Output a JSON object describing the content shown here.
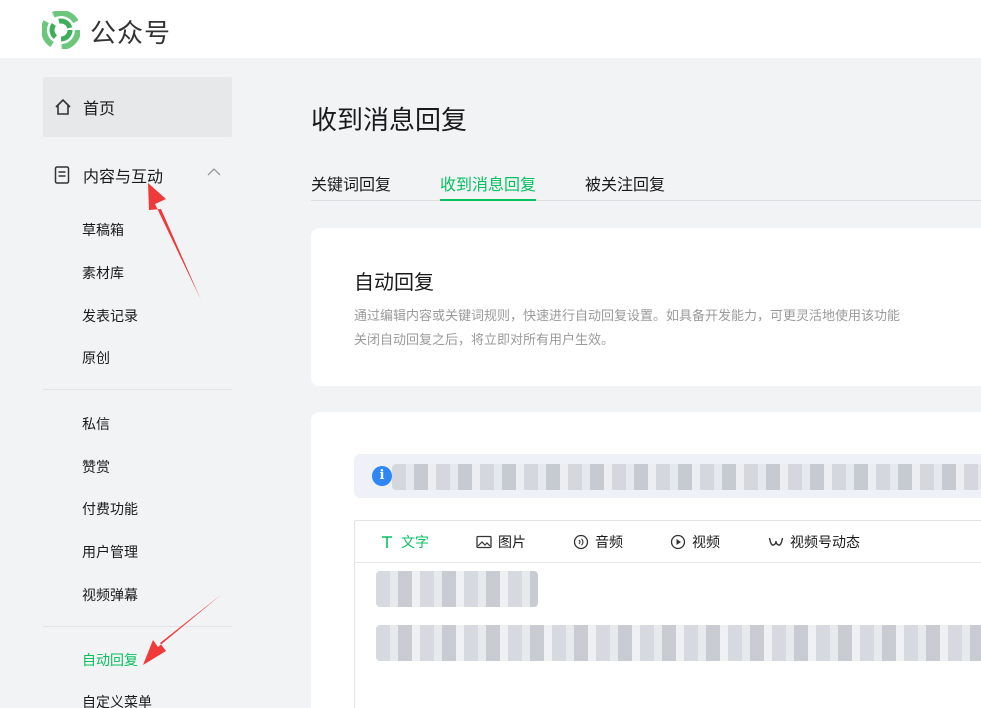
{
  "header": {
    "brand": "公众号"
  },
  "sidebar": {
    "home_label": "首页",
    "section_label": "内容与互动",
    "group1": [
      "草稿箱",
      "素材库",
      "发表记录",
      "原创"
    ],
    "group2": [
      "私信",
      "赞赏",
      "付费功能",
      "用户管理",
      "视频弹幕"
    ],
    "group3": [
      "自动回复",
      "自定义菜单"
    ],
    "active_item": "自动回复"
  },
  "main": {
    "title": "收到消息回复",
    "tabs": [
      "关键词回复",
      "收到消息回复",
      "被关注回复"
    ],
    "active_tab": "收到消息回复",
    "card": {
      "heading": "自动回复",
      "desc_line1": "通过编辑内容或关键词规则，快速进行自动回复设置。如具备开发能力，可更灵活地使用该功能",
      "desc_line2": "关闭自动回复之后，将立即对所有用户生效。"
    },
    "notice_icon": "i",
    "editor_tabs": [
      "文字",
      "图片",
      "音频",
      "视频",
      "视频号动态"
    ],
    "active_editor_tab": "文字"
  },
  "colors": {
    "accent": "#07c160",
    "annotation": "#f03a3a",
    "info": "#2f86f6"
  }
}
